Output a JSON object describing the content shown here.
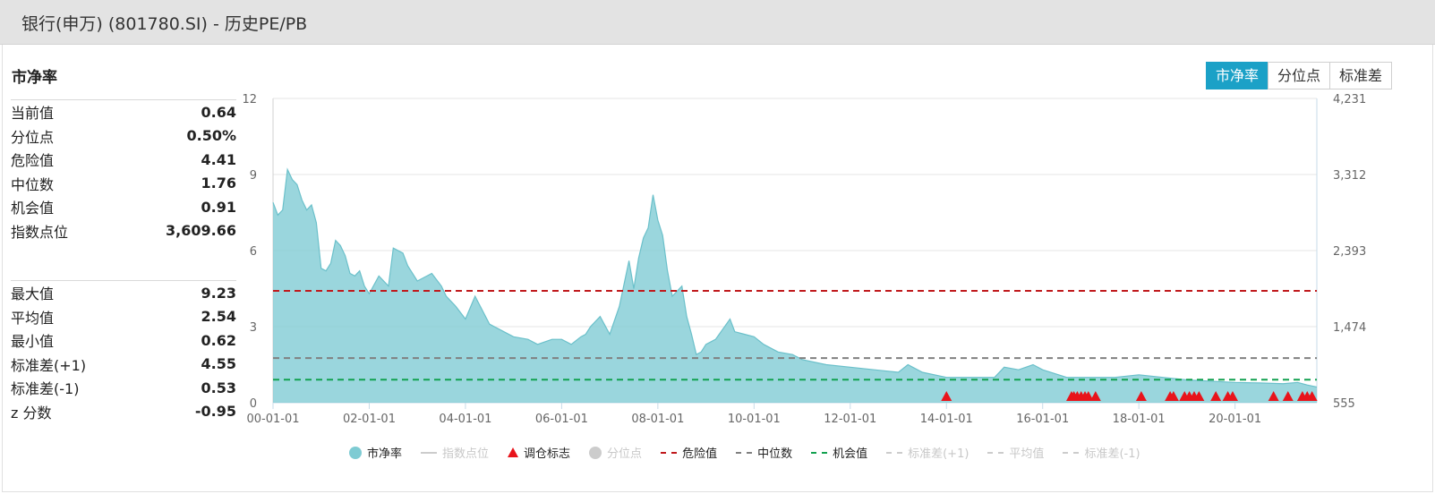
{
  "header": {
    "title": "银行(申万) (801780.SI) - 历史PE/PB"
  },
  "panel": {
    "title": "市净率",
    "group1": [
      {
        "label": "当前值",
        "value": "0.64"
      },
      {
        "label": "分位点",
        "value": "0.50%"
      },
      {
        "label": "危险值",
        "value": "4.41"
      },
      {
        "label": "中位数",
        "value": "1.76"
      },
      {
        "label": "机会值",
        "value": "0.91"
      },
      {
        "label": "指数点位",
        "value": "3,609.66"
      }
    ],
    "group2": [
      {
        "label": "最大值",
        "value": "9.23"
      },
      {
        "label": "平均值",
        "value": "2.54"
      },
      {
        "label": "最小值",
        "value": "0.62"
      },
      {
        "label": "标准差(+1)",
        "value": "4.55"
      },
      {
        "label": "标准差(-1)",
        "value": "0.53"
      },
      {
        "label": "z 分数",
        "value": "-0.95"
      }
    ]
  },
  "toggle": {
    "options": [
      "市净率",
      "分位点",
      "标准差"
    ],
    "active": 0
  },
  "legend": [
    {
      "label": "市净率",
      "marker": "circle",
      "color": "#7ecbd3",
      "enabled": true
    },
    {
      "label": "指数点位",
      "marker": "line",
      "color": "#cccccc",
      "enabled": false
    },
    {
      "label": "调仓标志",
      "marker": "triangle",
      "color": "#e8141b",
      "enabled": true
    },
    {
      "label": "分位点",
      "marker": "circle",
      "color": "#cccccc",
      "enabled": false
    },
    {
      "label": "危险值",
      "marker": "dash",
      "color": "#c0191c",
      "enabled": true
    },
    {
      "label": "中位数",
      "marker": "dash",
      "color": "#808080",
      "enabled": true
    },
    {
      "label": "机会值",
      "marker": "dash",
      "color": "#12a150",
      "enabled": true
    },
    {
      "label": "标准差(+1)",
      "marker": "dash",
      "color": "#cccccc",
      "enabled": false
    },
    {
      "label": "平均值",
      "marker": "dash",
      "color": "#cccccc",
      "enabled": false
    },
    {
      "label": "标准差(-1)",
      "marker": "dash",
      "color": "#cccccc",
      "enabled": false
    }
  ],
  "chart_data": {
    "type": "area",
    "title": "",
    "xlabel": "",
    "ylabel": "",
    "xlim": [
      2000.0,
      2021.7
    ],
    "ylim": [
      0,
      12
    ],
    "y_ticks": [
      "0",
      "3",
      "6",
      "9",
      "12"
    ],
    "y2_ticks": [
      "555",
      "1,474",
      "2,393",
      "3,312",
      "4,231"
    ],
    "x_ticks": [
      {
        "label": "00-01-01",
        "x": 2000.0
      },
      {
        "label": "02-01-01",
        "x": 2002.0
      },
      {
        "label": "04-01-01",
        "x": 2004.0
      },
      {
        "label": "06-01-01",
        "x": 2006.0
      },
      {
        "label": "08-01-01",
        "x": 2008.0
      },
      {
        "label": "10-01-01",
        "x": 2010.0
      },
      {
        "label": "12-01-01",
        "x": 2012.0
      },
      {
        "label": "14-01-01",
        "x": 2014.0
      },
      {
        "label": "16-01-01",
        "x": 2016.0
      },
      {
        "label": "18-01-01",
        "x": 2018.0
      },
      {
        "label": "20-01-01",
        "x": 2020.0
      }
    ],
    "series": [
      {
        "name": "市净率",
        "color": "#7ecbd3",
        "x": [
          2000.0,
          2000.1,
          2000.2,
          2000.3,
          2000.4,
          2000.5,
          2000.6,
          2000.7,
          2000.8,
          2000.9,
          2001.0,
          2001.1,
          2001.2,
          2001.3,
          2001.4,
          2001.5,
          2001.6,
          2001.7,
          2001.8,
          2001.9,
          2002.0,
          2002.2,
          2002.4,
          2002.5,
          2002.7,
          2002.8,
          2003.0,
          2003.3,
          2003.5,
          2003.6,
          2003.8,
          2004.0,
          2004.2,
          2004.5,
          2004.8,
          2005.0,
          2005.3,
          2005.5,
          2005.8,
          2006.0,
          2006.2,
          2006.4,
          2006.5,
          2006.6,
          2006.8,
          2007.0,
          2007.2,
          2007.4,
          2007.5,
          2007.6,
          2007.7,
          2007.8,
          2007.9,
          2008.0,
          2008.1,
          2008.2,
          2008.3,
          2008.5,
          2008.6,
          2008.7,
          2008.8,
          2008.9,
          2009.0,
          2009.2,
          2009.5,
          2009.6,
          2009.8,
          2010.0,
          2010.2,
          2010.5,
          2010.8,
          2011.0,
          2011.5,
          2012.0,
          2012.5,
          2013.0,
          2013.2,
          2013.5,
          2014.0,
          2014.5,
          2015.0,
          2015.2,
          2015.5,
          2015.8,
          2016.0,
          2016.5,
          2017.0,
          2017.5,
          2018.0,
          2018.5,
          2019.0,
          2019.5,
          2020.0,
          2020.5,
          2021.0,
          2021.3,
          2021.5,
          2021.7
        ],
        "values": [
          7.9,
          7.4,
          7.6,
          9.2,
          8.8,
          8.6,
          8.0,
          7.6,
          7.8,
          7.1,
          5.3,
          5.2,
          5.5,
          6.4,
          6.2,
          5.8,
          5.1,
          5.0,
          5.2,
          4.6,
          4.3,
          5.0,
          4.6,
          6.1,
          5.9,
          5.4,
          4.8,
          5.1,
          4.6,
          4.2,
          3.8,
          3.3,
          4.2,
          3.1,
          2.8,
          2.6,
          2.5,
          2.3,
          2.5,
          2.5,
          2.3,
          2.6,
          2.7,
          3.0,
          3.4,
          2.7,
          3.8,
          5.6,
          4.5,
          5.7,
          6.5,
          6.9,
          8.2,
          7.2,
          6.6,
          5.2,
          4.2,
          4.6,
          3.4,
          2.7,
          1.9,
          2.0,
          2.3,
          2.5,
          3.3,
          2.8,
          2.7,
          2.6,
          2.3,
          2.0,
          1.9,
          1.7,
          1.5,
          1.4,
          1.3,
          1.2,
          1.5,
          1.2,
          1.0,
          1.0,
          1.0,
          1.4,
          1.3,
          1.5,
          1.3,
          1.0,
          1.0,
          1.0,
          1.1,
          1.0,
          0.9,
          0.85,
          0.8,
          0.78,
          0.75,
          0.8,
          0.7,
          0.62
        ]
      }
    ],
    "reference_lines": [
      {
        "name": "危险值",
        "value": 4.41,
        "color": "#c0191c"
      },
      {
        "name": "中位数",
        "value": 1.76,
        "color": "#808080"
      },
      {
        "name": "机会值",
        "value": 0.91,
        "color": "#12a150"
      }
    ],
    "rebalance_markers": {
      "name": "调仓标志",
      "color": "#e8141b",
      "x": [
        2014.0,
        2016.6,
        2016.65,
        2016.72,
        2016.8,
        2016.88,
        2016.95,
        2017.1,
        2018.05,
        2018.65,
        2018.72,
        2018.95,
        2019.05,
        2019.15,
        2019.25,
        2019.6,
        2019.85,
        2019.95,
        2020.8,
        2021.1,
        2021.4,
        2021.5,
        2021.6
      ]
    },
    "grid": true,
    "legend_position": "bottom"
  }
}
